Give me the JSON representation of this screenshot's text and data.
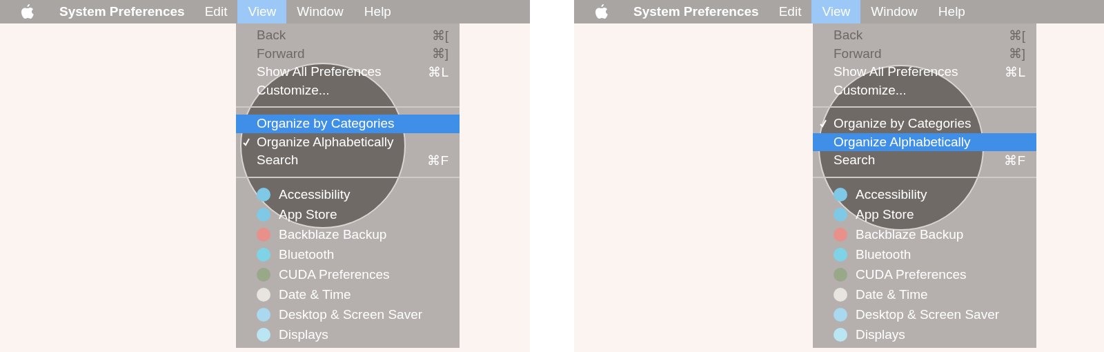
{
  "panels": [
    {
      "menu_bar": {
        "app_name": "System Preferences",
        "menus": [
          {
            "label": "Edit",
            "selected": false
          },
          {
            "label": "View",
            "selected": true
          },
          {
            "label": "Window",
            "selected": false
          },
          {
            "label": "Help",
            "selected": false
          }
        ]
      },
      "view_menu": {
        "items": [
          {
            "kind": "command",
            "label": "Back",
            "shortcut": "⌘[",
            "disabled": true,
            "checked": false,
            "selected": false
          },
          {
            "kind": "command",
            "label": "Forward",
            "shortcut": "⌘]",
            "disabled": true,
            "checked": false,
            "selected": false
          },
          {
            "kind": "command",
            "label": "Show All Preferences",
            "shortcut": "⌘L",
            "disabled": false,
            "checked": false,
            "selected": false
          },
          {
            "kind": "command",
            "label": "Customize...",
            "disabled": false,
            "checked": false,
            "selected": false
          },
          {
            "kind": "separator"
          },
          {
            "kind": "command",
            "label": "Organize by Categories",
            "disabled": false,
            "checked": false,
            "selected": true
          },
          {
            "kind": "command",
            "label": "Organize Alphabetically",
            "disabled": false,
            "checked": true,
            "selected": false
          },
          {
            "kind": "command",
            "label": "Search",
            "shortcut": "⌘F",
            "disabled": false,
            "checked": false,
            "selected": false
          },
          {
            "kind": "separator"
          },
          {
            "kind": "pane",
            "label": "Accessibility"
          },
          {
            "kind": "pane",
            "label": "App Store"
          },
          {
            "kind": "pane",
            "label": "Backblaze Backup"
          },
          {
            "kind": "pane",
            "label": "Bluetooth"
          },
          {
            "kind": "pane",
            "label": "CUDA Preferences"
          },
          {
            "kind": "pane",
            "label": "Date & Time"
          },
          {
            "kind": "pane",
            "label": "Desktop & Screen Saver"
          },
          {
            "kind": "pane",
            "label": "Displays"
          }
        ]
      }
    },
    {
      "menu_bar": {
        "app_name": "System Preferences",
        "menus": [
          {
            "label": "Edit",
            "selected": false
          },
          {
            "label": "View",
            "selected": true
          },
          {
            "label": "Window",
            "selected": false
          },
          {
            "label": "Help",
            "selected": false
          }
        ]
      },
      "view_menu": {
        "items": [
          {
            "kind": "command",
            "label": "Back",
            "shortcut": "⌘[",
            "disabled": true,
            "checked": false,
            "selected": false
          },
          {
            "kind": "command",
            "label": "Forward",
            "shortcut": "⌘]",
            "disabled": true,
            "checked": false,
            "selected": false
          },
          {
            "kind": "command",
            "label": "Show All Preferences",
            "shortcut": "⌘L",
            "disabled": false,
            "checked": false,
            "selected": false
          },
          {
            "kind": "command",
            "label": "Customize...",
            "disabled": false,
            "checked": false,
            "selected": false
          },
          {
            "kind": "separator"
          },
          {
            "kind": "command",
            "label": "Organize by Categories",
            "disabled": false,
            "checked": true,
            "selected": false
          },
          {
            "kind": "command",
            "label": "Organize Alphabetically",
            "disabled": false,
            "checked": false,
            "selected": true
          },
          {
            "kind": "command",
            "label": "Search",
            "shortcut": "⌘F",
            "disabled": false,
            "checked": false,
            "selected": false
          },
          {
            "kind": "separator"
          },
          {
            "kind": "pane",
            "label": "Accessibility"
          },
          {
            "kind": "pane",
            "label": "App Store"
          },
          {
            "kind": "pane",
            "label": "Backblaze Backup"
          },
          {
            "kind": "pane",
            "label": "Bluetooth"
          },
          {
            "kind": "pane",
            "label": "CUDA Preferences"
          },
          {
            "kind": "pane",
            "label": "Date & Time"
          },
          {
            "kind": "pane",
            "label": "Desktop & Screen Saver"
          },
          {
            "kind": "pane",
            "label": "Displays"
          }
        ]
      }
    }
  ]
}
